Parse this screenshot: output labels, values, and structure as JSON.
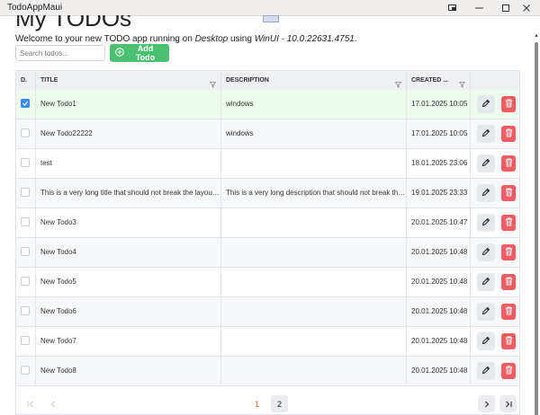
{
  "window": {
    "title": "TodoAppMaui",
    "minimize_icon": "minimize-icon",
    "maximize_icon": "maximize-icon",
    "close_icon": "close-icon"
  },
  "header": {
    "page_title": "My TODOs",
    "welcome_prefix": "Welcome to your new TODO app running on ",
    "platform": "Desktop",
    "welcome_mid": " using ",
    "framework": "WinUI - 10.0.22631.4751",
    "welcome_suffix": "."
  },
  "toolbar": {
    "search_placeholder": "Search todos...",
    "add_label": "Add Todo"
  },
  "table": {
    "columns": [
      "D.",
      "TITLE",
      "DESCRIPTION",
      "CREATED ..."
    ],
    "rows": [
      {
        "done": true,
        "title": "New Todo1",
        "description": "windows",
        "created": "17.01.2025 10:05"
      },
      {
        "done": false,
        "title": "New Todo22222",
        "description": "windows",
        "created": "17.01.2025 10:05"
      },
      {
        "done": false,
        "title": "test",
        "description": "",
        "created": "18.01.2025 23:06"
      },
      {
        "done": false,
        "title": "This is a very long title that should not break the layout …",
        "description": "This is a very long description that should not break the…",
        "created": "19.01.2025 23:33"
      },
      {
        "done": false,
        "title": "New Todo3",
        "description": "",
        "created": "20.01.2025 10:47"
      },
      {
        "done": false,
        "title": "New Todo4",
        "description": "",
        "created": "20.01.2025 10:48"
      },
      {
        "done": false,
        "title": "New Todo5",
        "description": "",
        "created": "20.01.2025 10:48"
      },
      {
        "done": false,
        "title": "New Todo6",
        "description": "",
        "created": "20.01.2025 10:48"
      },
      {
        "done": false,
        "title": "New Todo7",
        "description": "",
        "created": "20.01.2025 10:48"
      },
      {
        "done": false,
        "title": "New Todo8",
        "description": "",
        "created": "20.01.2025 10:48"
      }
    ]
  },
  "pagination": {
    "pages": [
      "1",
      "2"
    ],
    "current_page": "1"
  },
  "colors": {
    "add_button": "#4cc071",
    "delete_button": "#ef5d63",
    "checkbox_checked": "#3b8bf0",
    "selected_row": "#eefaee",
    "active_page": "#e45b2f"
  }
}
